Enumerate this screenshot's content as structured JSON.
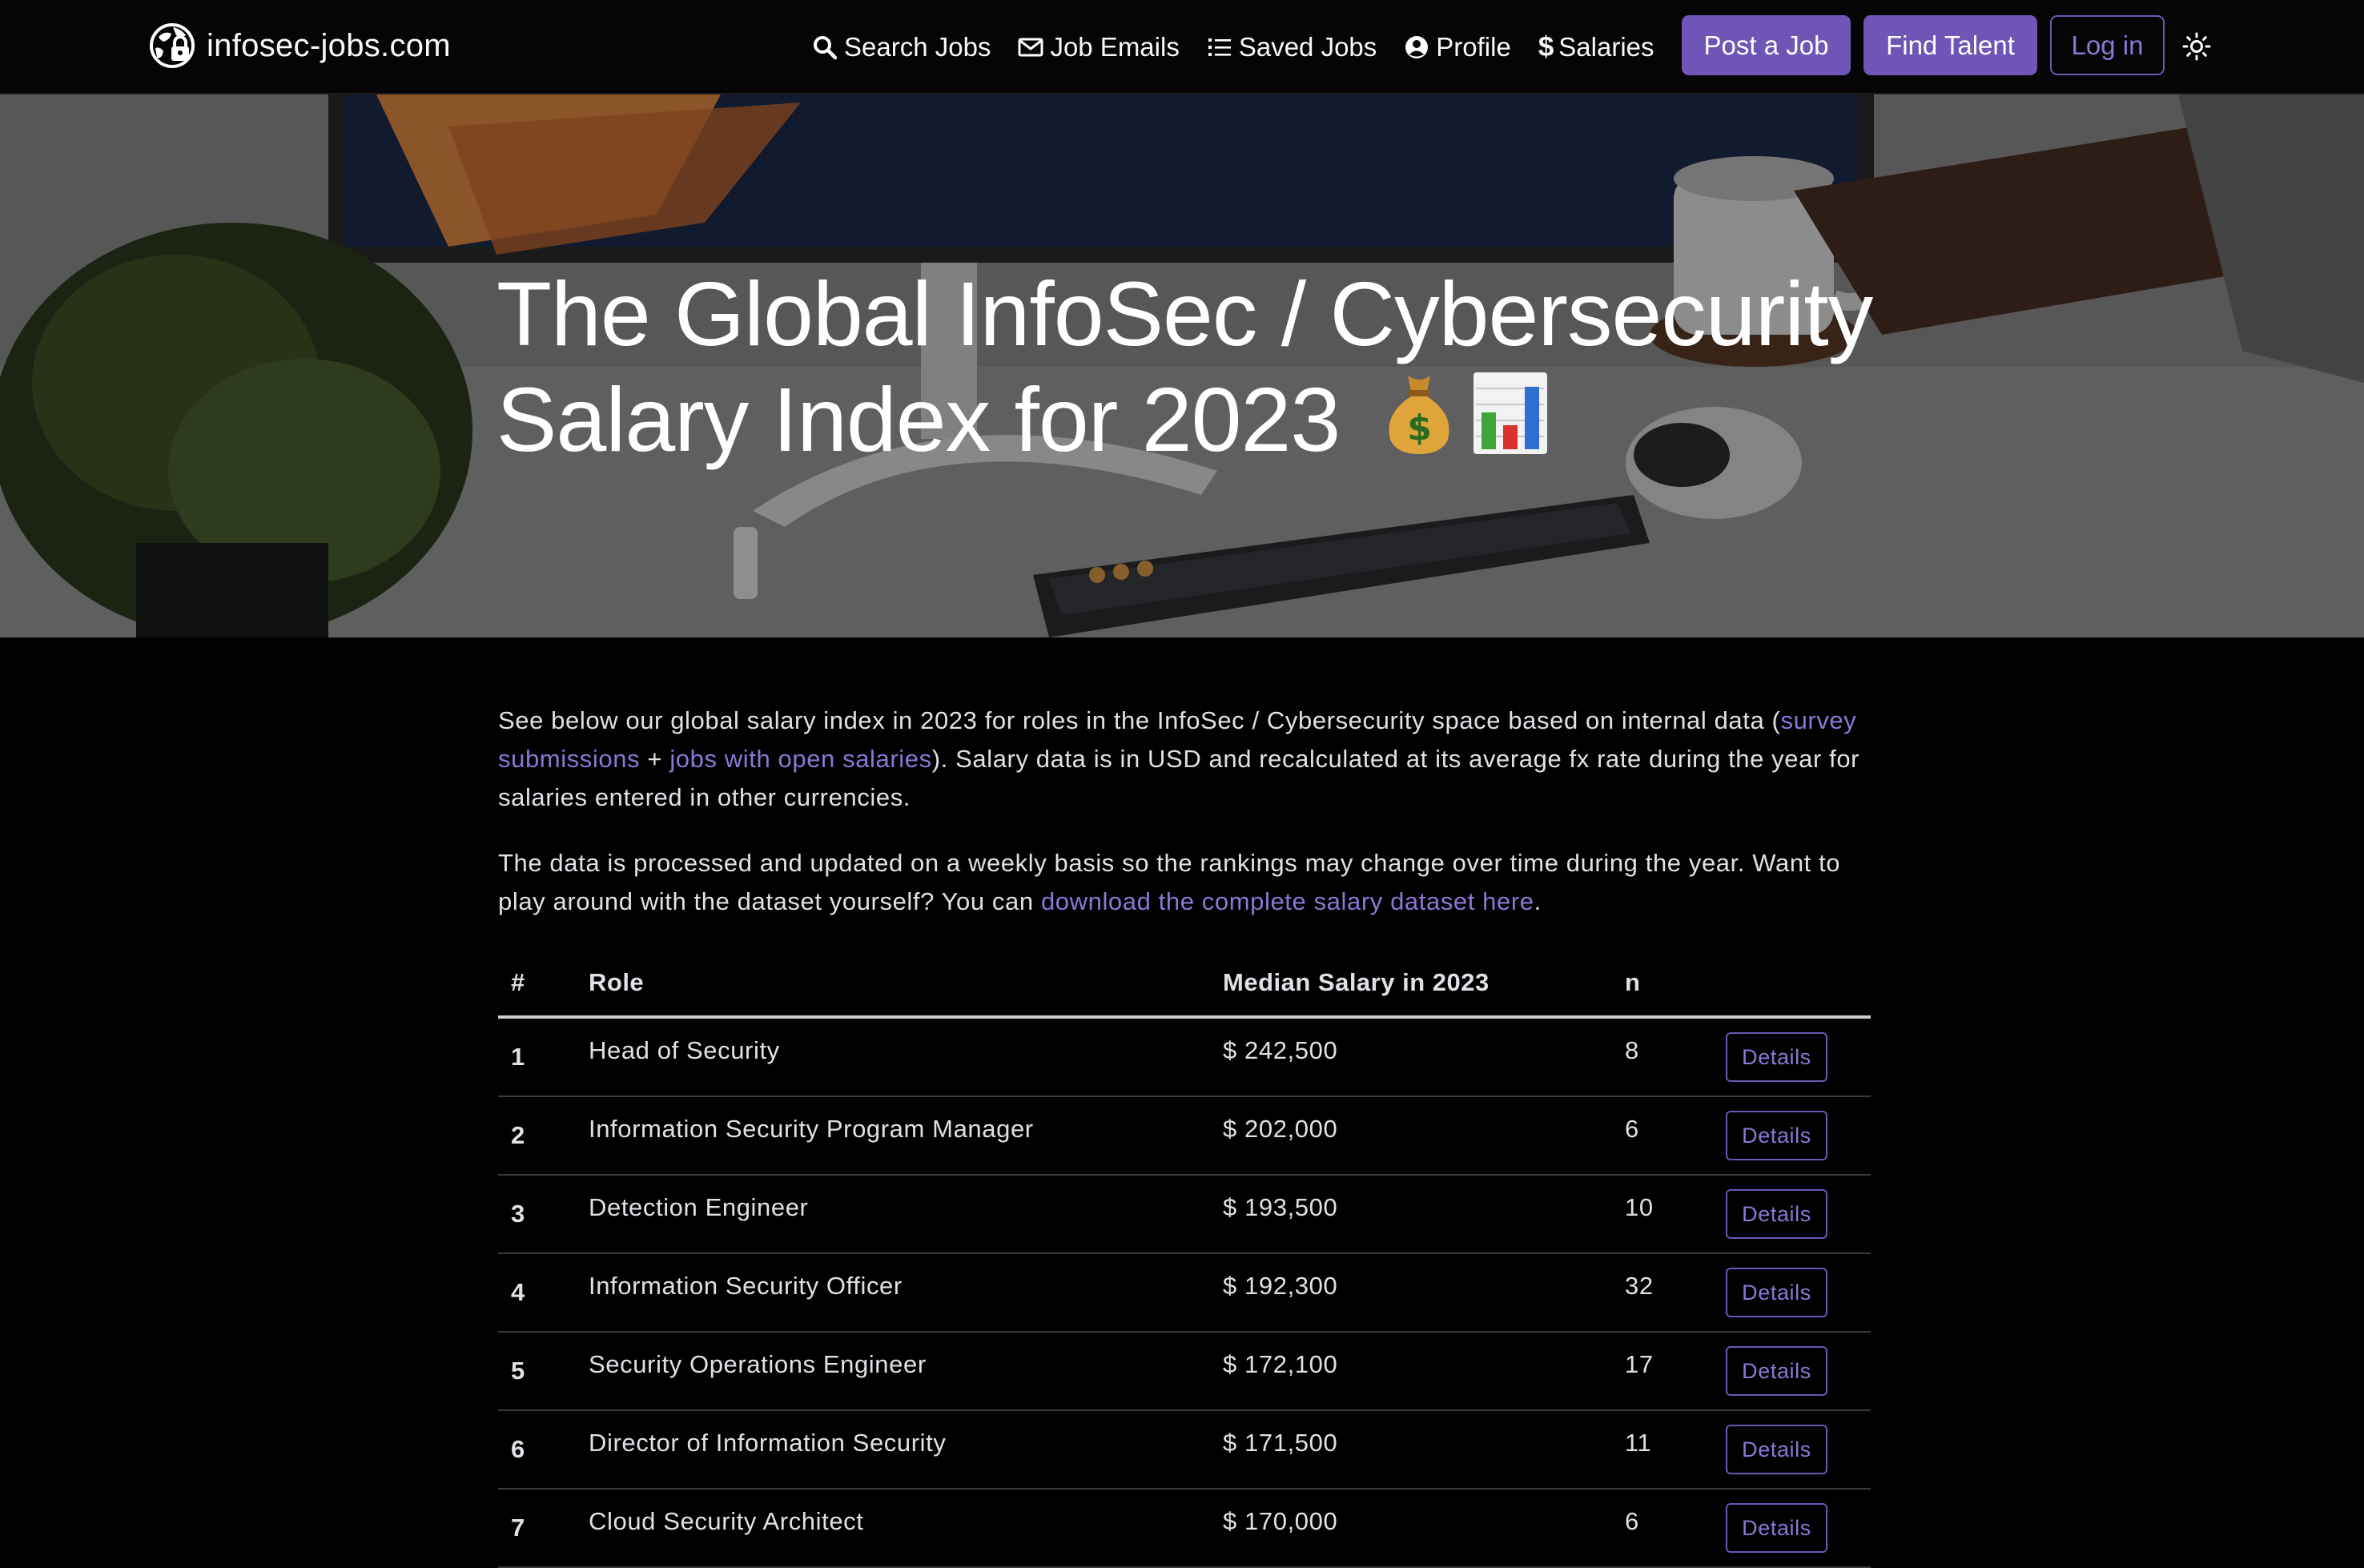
{
  "brand": {
    "name": "infosec-jobs.com",
    "logo_icon": "globe-lock-icon"
  },
  "nav": {
    "items": [
      {
        "label": "Search Jobs",
        "icon": "search-icon"
      },
      {
        "label": "Job Emails",
        "icon": "envelope-icon"
      },
      {
        "label": "Saved Jobs",
        "icon": "list-icon"
      },
      {
        "label": "Profile",
        "icon": "user-circle-icon"
      },
      {
        "label": "Salaries",
        "icon": "dollar-icon",
        "icon_glyph": "$"
      }
    ],
    "post_job": "Post a Job",
    "find_talent": "Find Talent",
    "login": "Log in",
    "theme_icon": "sun-icon"
  },
  "hero": {
    "title": "The Global InfoSec / Cybersecurity Salary Index for 2023",
    "emoji_icons": [
      "money-bag-icon",
      "bar-chart-icon"
    ]
  },
  "intro": {
    "p1_before": "See below our global salary index in 2023 for roles in the InfoSec / Cybersecurity space based on internal data (",
    "p1_link1": "survey submissions",
    "p1_plus": " + ",
    "p1_link2": "jobs with open salaries",
    "p1_after": "). Salary data is in USD and recalculated at its average fx rate during the year for salaries entered in other currencies.",
    "p2_before": "The data is processed and updated on a weekly basis so the rankings may change over time during the year. Want to play around with the dataset yourself? You can ",
    "p2_link": "download the complete salary dataset here",
    "p2_after": "."
  },
  "table": {
    "headers": {
      "num": "#",
      "role": "Role",
      "salary": "Median Salary in 2023",
      "n": "n"
    },
    "details_label": "Details",
    "rows": [
      {
        "num": "1",
        "role": "Head of Security",
        "salary": "$ 242,500",
        "n": "8"
      },
      {
        "num": "2",
        "role": "Information Security Program Manager",
        "salary": "$ 202,000",
        "n": "6"
      },
      {
        "num": "3",
        "role": "Detection Engineer",
        "salary": "$ 193,500",
        "n": "10"
      },
      {
        "num": "4",
        "role": "Information Security Officer",
        "salary": "$ 192,300",
        "n": "32"
      },
      {
        "num": "5",
        "role": "Security Operations Engineer",
        "salary": "$ 172,100",
        "n": "17"
      },
      {
        "num": "6",
        "role": "Director of Information Security",
        "salary": "$ 171,500",
        "n": "11"
      },
      {
        "num": "7",
        "role": "Cloud Security Architect",
        "salary": "$ 170,000",
        "n": "6"
      }
    ]
  },
  "colors": {
    "background": "#000000",
    "accent": "#6f55b5",
    "link": "#8c77d6",
    "text": "#dee2e6"
  }
}
